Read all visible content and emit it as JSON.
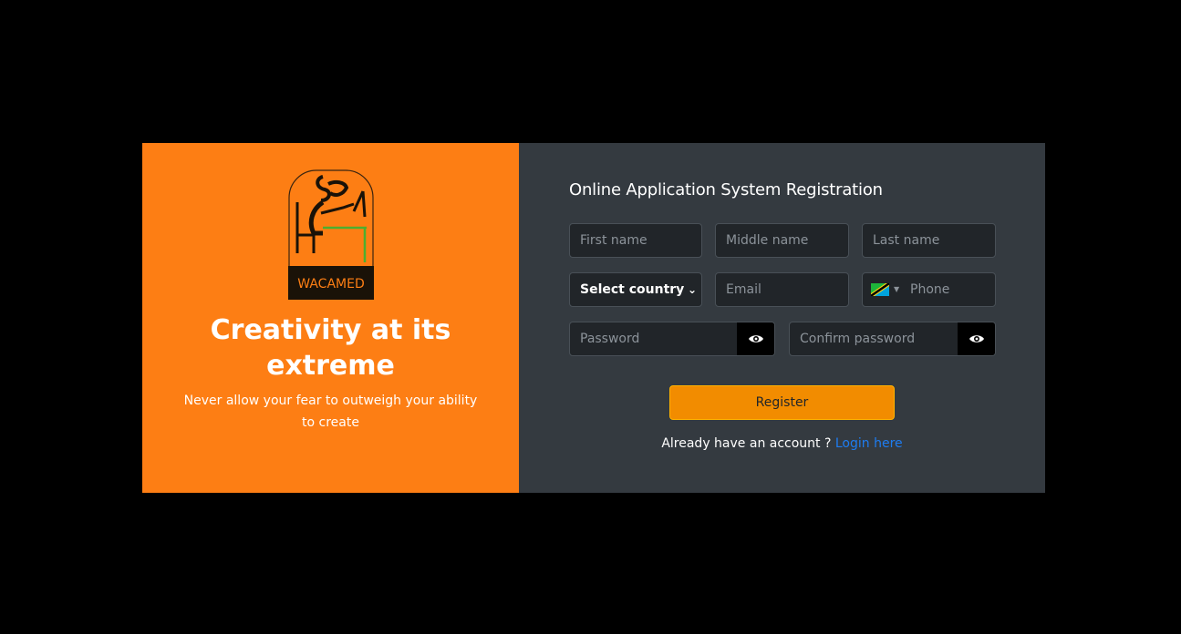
{
  "hero": {
    "logo_text": "WACAMED",
    "tagline": "Creativity at its extreme",
    "subline": "Never allow your fear to outweigh your ability to create"
  },
  "form": {
    "title": "Online Application System Registration",
    "first_name": {
      "placeholder": "First name"
    },
    "middle_name": {
      "placeholder": "Middle name"
    },
    "last_name": {
      "placeholder": "Last name"
    },
    "country": {
      "selected": "Select country"
    },
    "email": {
      "placeholder": "Email"
    },
    "phone": {
      "placeholder": "Phone",
      "country_flag": "tanzania-flag-icon"
    },
    "password": {
      "placeholder": "Password"
    },
    "confirm_password": {
      "placeholder": "Confirm password"
    },
    "register_label": "Register",
    "login_prompt": "Already have an account ?",
    "login_link": "Login here"
  },
  "colors": {
    "hero_bg": "#fd7e14",
    "form_bg": "#343a40",
    "input_bg": "#212529",
    "button_bg": "#f28c00",
    "link": "#1e7cf0"
  }
}
